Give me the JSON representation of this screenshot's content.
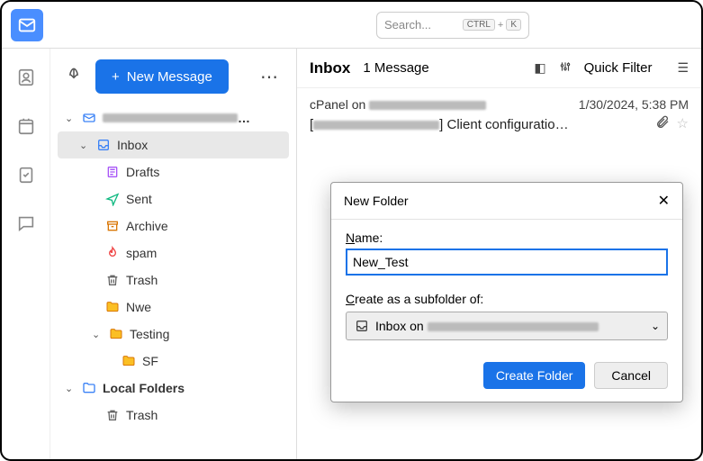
{
  "search": {
    "placeholder": "Search...",
    "shortcut_ctrl": "CTRL",
    "shortcut_plus": "+",
    "shortcut_k": "K"
  },
  "toolbar": {
    "new_message": "New Message"
  },
  "account": {
    "name_redacted": true
  },
  "folders": {
    "inbox": "Inbox",
    "drafts": "Drafts",
    "sent": "Sent",
    "archive": "Archive",
    "spam": "spam",
    "trash": "Trash",
    "nwe": "Nwe",
    "testing": "Testing",
    "sf": "SF",
    "local": "Local Folders",
    "local_trash": "Trash"
  },
  "main": {
    "title": "Inbox",
    "count": "1 Message",
    "quick_filter": "Quick Filter"
  },
  "message": {
    "sender_prefix": "cPanel on ",
    "date": "1/30/2024, 5:38 PM",
    "subject_prefix": "[",
    "subject_suffix": "] Client configuratio…"
  },
  "dialog": {
    "title": "New Folder",
    "name_label_u": "N",
    "name_label_rest": "ame:",
    "name_value": "New_Test",
    "subfolder_label_u": "C",
    "subfolder_label_rest": "reate as a subfolder of:",
    "subfolder_value": "Inbox on ",
    "create": "Create Folder",
    "cancel": "Cancel"
  }
}
